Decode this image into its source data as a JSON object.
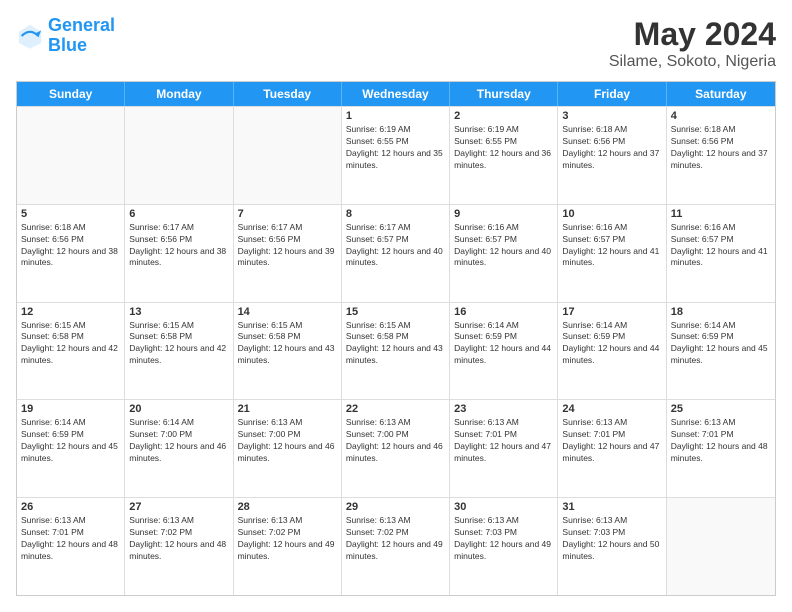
{
  "logo": {
    "line1": "General",
    "line2": "Blue"
  },
  "title": "May 2024",
  "subtitle": "Silame, Sokoto, Nigeria",
  "header_days": [
    "Sunday",
    "Monday",
    "Tuesday",
    "Wednesday",
    "Thursday",
    "Friday",
    "Saturday"
  ],
  "weeks": [
    [
      {
        "day": "",
        "info": ""
      },
      {
        "day": "",
        "info": ""
      },
      {
        "day": "",
        "info": ""
      },
      {
        "day": "1",
        "info": "Sunrise: 6:19 AM\nSunset: 6:55 PM\nDaylight: 12 hours and 35 minutes."
      },
      {
        "day": "2",
        "info": "Sunrise: 6:19 AM\nSunset: 6:55 PM\nDaylight: 12 hours and 36 minutes."
      },
      {
        "day": "3",
        "info": "Sunrise: 6:18 AM\nSunset: 6:56 PM\nDaylight: 12 hours and 37 minutes."
      },
      {
        "day": "4",
        "info": "Sunrise: 6:18 AM\nSunset: 6:56 PM\nDaylight: 12 hours and 37 minutes."
      }
    ],
    [
      {
        "day": "5",
        "info": "Sunrise: 6:18 AM\nSunset: 6:56 PM\nDaylight: 12 hours and 38 minutes."
      },
      {
        "day": "6",
        "info": "Sunrise: 6:17 AM\nSunset: 6:56 PM\nDaylight: 12 hours and 38 minutes."
      },
      {
        "day": "7",
        "info": "Sunrise: 6:17 AM\nSunset: 6:56 PM\nDaylight: 12 hours and 39 minutes."
      },
      {
        "day": "8",
        "info": "Sunrise: 6:17 AM\nSunset: 6:57 PM\nDaylight: 12 hours and 40 minutes."
      },
      {
        "day": "9",
        "info": "Sunrise: 6:16 AM\nSunset: 6:57 PM\nDaylight: 12 hours and 40 minutes."
      },
      {
        "day": "10",
        "info": "Sunrise: 6:16 AM\nSunset: 6:57 PM\nDaylight: 12 hours and 41 minutes."
      },
      {
        "day": "11",
        "info": "Sunrise: 6:16 AM\nSunset: 6:57 PM\nDaylight: 12 hours and 41 minutes."
      }
    ],
    [
      {
        "day": "12",
        "info": "Sunrise: 6:15 AM\nSunset: 6:58 PM\nDaylight: 12 hours and 42 minutes."
      },
      {
        "day": "13",
        "info": "Sunrise: 6:15 AM\nSunset: 6:58 PM\nDaylight: 12 hours and 42 minutes."
      },
      {
        "day": "14",
        "info": "Sunrise: 6:15 AM\nSunset: 6:58 PM\nDaylight: 12 hours and 43 minutes."
      },
      {
        "day": "15",
        "info": "Sunrise: 6:15 AM\nSunset: 6:58 PM\nDaylight: 12 hours and 43 minutes."
      },
      {
        "day": "16",
        "info": "Sunrise: 6:14 AM\nSunset: 6:59 PM\nDaylight: 12 hours and 44 minutes."
      },
      {
        "day": "17",
        "info": "Sunrise: 6:14 AM\nSunset: 6:59 PM\nDaylight: 12 hours and 44 minutes."
      },
      {
        "day": "18",
        "info": "Sunrise: 6:14 AM\nSunset: 6:59 PM\nDaylight: 12 hours and 45 minutes."
      }
    ],
    [
      {
        "day": "19",
        "info": "Sunrise: 6:14 AM\nSunset: 6:59 PM\nDaylight: 12 hours and 45 minutes."
      },
      {
        "day": "20",
        "info": "Sunrise: 6:14 AM\nSunset: 7:00 PM\nDaylight: 12 hours and 46 minutes."
      },
      {
        "day": "21",
        "info": "Sunrise: 6:13 AM\nSunset: 7:00 PM\nDaylight: 12 hours and 46 minutes."
      },
      {
        "day": "22",
        "info": "Sunrise: 6:13 AM\nSunset: 7:00 PM\nDaylight: 12 hours and 46 minutes."
      },
      {
        "day": "23",
        "info": "Sunrise: 6:13 AM\nSunset: 7:01 PM\nDaylight: 12 hours and 47 minutes."
      },
      {
        "day": "24",
        "info": "Sunrise: 6:13 AM\nSunset: 7:01 PM\nDaylight: 12 hours and 47 minutes."
      },
      {
        "day": "25",
        "info": "Sunrise: 6:13 AM\nSunset: 7:01 PM\nDaylight: 12 hours and 48 minutes."
      }
    ],
    [
      {
        "day": "26",
        "info": "Sunrise: 6:13 AM\nSunset: 7:01 PM\nDaylight: 12 hours and 48 minutes."
      },
      {
        "day": "27",
        "info": "Sunrise: 6:13 AM\nSunset: 7:02 PM\nDaylight: 12 hours and 48 minutes."
      },
      {
        "day": "28",
        "info": "Sunrise: 6:13 AM\nSunset: 7:02 PM\nDaylight: 12 hours and 49 minutes."
      },
      {
        "day": "29",
        "info": "Sunrise: 6:13 AM\nSunset: 7:02 PM\nDaylight: 12 hours and 49 minutes."
      },
      {
        "day": "30",
        "info": "Sunrise: 6:13 AM\nSunset: 7:03 PM\nDaylight: 12 hours and 49 minutes."
      },
      {
        "day": "31",
        "info": "Sunrise: 6:13 AM\nSunset: 7:03 PM\nDaylight: 12 hours and 50 minutes."
      },
      {
        "day": "",
        "info": ""
      }
    ]
  ]
}
